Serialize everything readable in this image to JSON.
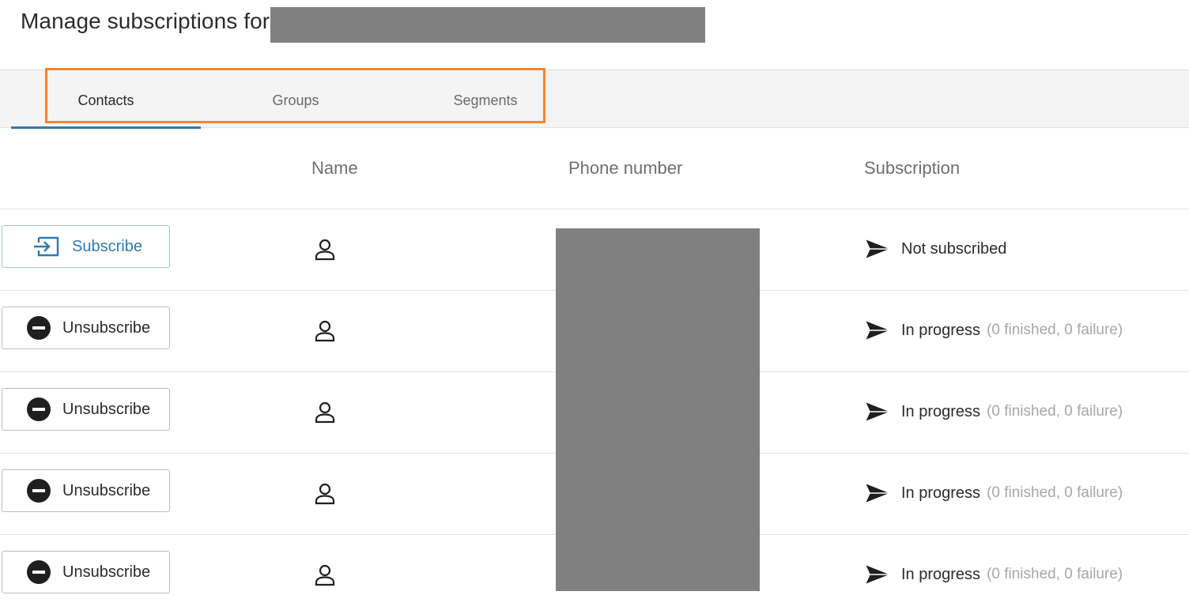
{
  "header": {
    "title": "Manage subscriptions for"
  },
  "tabs": [
    {
      "label": "Contacts",
      "active": true
    },
    {
      "label": "Groups",
      "active": false
    },
    {
      "label": "Segments",
      "active": false
    }
  ],
  "colors": {
    "accent": "#2e7bb0",
    "highlight": "#f5862f",
    "redaction": "#808080"
  },
  "table": {
    "columns": [
      "Name",
      "Phone number",
      "Subscription"
    ],
    "rows": [
      {
        "action_label": "Subscribe",
        "action_icon": "enter-icon",
        "status": "Not subscribed",
        "detail": ""
      },
      {
        "action_label": "Unsubscribe",
        "action_icon": "minus-circle-icon",
        "status": "In progress",
        "detail": "(0 finished, 0 failure)"
      },
      {
        "action_label": "Unsubscribe",
        "action_icon": "minus-circle-icon",
        "status": "In progress",
        "detail": "(0 finished, 0 failure)"
      },
      {
        "action_label": "Unsubscribe",
        "action_icon": "minus-circle-icon",
        "status": "In progress",
        "detail": "(0 finished, 0 failure)"
      },
      {
        "action_label": "Unsubscribe",
        "action_icon": "minus-circle-icon",
        "status": "In progress",
        "detail": "(0 finished, 0 failure)"
      }
    ]
  }
}
